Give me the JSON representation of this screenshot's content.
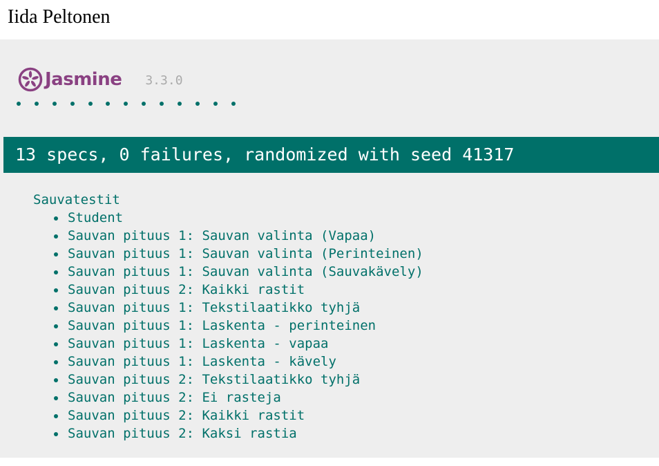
{
  "page": {
    "heading": "Iida Peltonen"
  },
  "jasmine": {
    "logo_text": "Jasmine",
    "logo_icon": "jasmine-flower-icon",
    "version": "3.3.0",
    "brand_color": "#8a4182",
    "pass_color": "#007069",
    "passed_spec_count": 13
  },
  "summary": {
    "text": "13 specs, 0 failures, randomized with seed 41317"
  },
  "suite": {
    "title": "Sauvatestit",
    "specs": [
      "Student",
      "Sauvan pituus 1: Sauvan valinta (Vapaa)",
      "Sauvan pituus 1: Sauvan valinta (Perinteinen)",
      "Sauvan pituus 1: Sauvan valinta (Sauvakävely)",
      "Sauvan pituus 2: Kaikki rastit",
      "Sauvan pituus 1: Tekstilaatikko tyhjä",
      "Sauvan pituus 1: Laskenta - perinteinen",
      "Sauvan pituus 1: Laskenta - vapaa",
      "Sauvan pituus 1: Laskenta - kävely",
      "Sauvan pituus 2: Tekstilaatikko tyhjä",
      "Sauvan pituus 2: Ei rasteja",
      "Sauvan pituus 2: Kaikki rastit",
      "Sauvan pituus 2: Kaksi rastia"
    ]
  }
}
